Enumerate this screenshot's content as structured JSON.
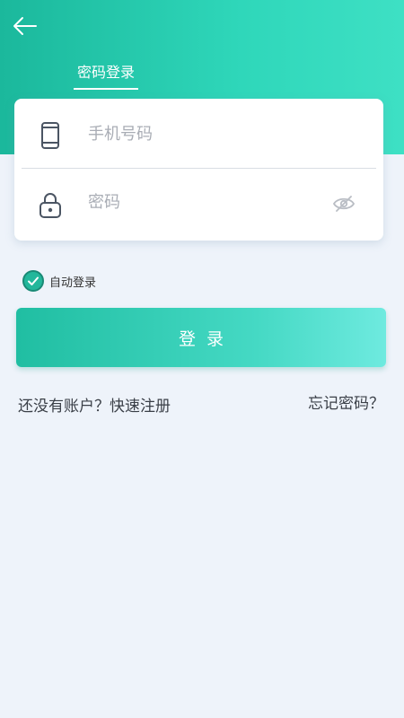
{
  "colors": {
    "accent": "#23b79b",
    "header_gradient_start": "#1bb89c",
    "header_gradient_end": "#3ee0c4",
    "page_background": "#eef3fa"
  },
  "header": {
    "back_icon": "arrow-left-icon",
    "tab_label": "密码登录"
  },
  "form": {
    "phone": {
      "icon": "phone-icon",
      "placeholder": "手机号码",
      "value": ""
    },
    "password": {
      "icon": "lock-icon",
      "placeholder": "密码",
      "value": "",
      "toggle_icon": "eye-hidden-icon"
    }
  },
  "auto_login": {
    "label": "自动登录",
    "checked": true
  },
  "login_button": {
    "label": "登录"
  },
  "links": {
    "register": "还没有账户？快速注册",
    "forgot": "忘记密码？"
  }
}
